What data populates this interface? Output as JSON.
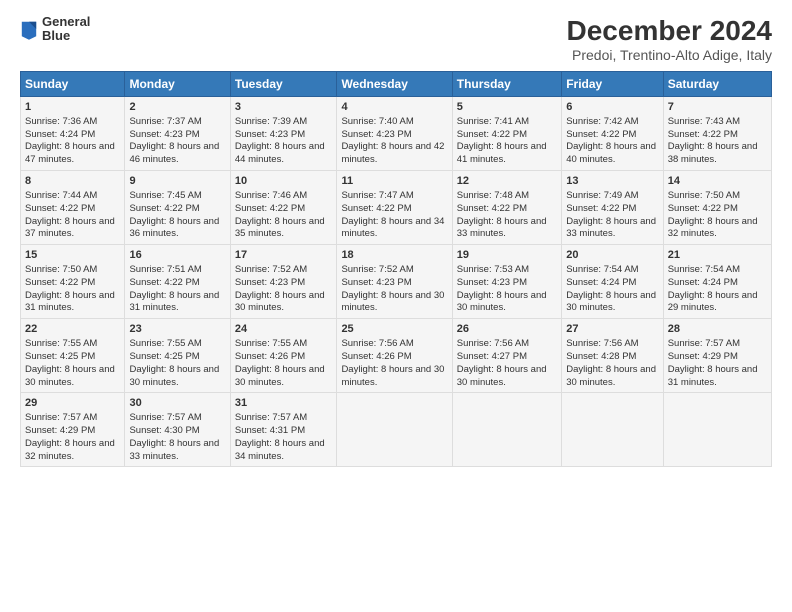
{
  "header": {
    "logo_line1": "General",
    "logo_line2": "Blue",
    "main_title": "December 2024",
    "subtitle": "Predoi, Trentino-Alto Adige, Italy"
  },
  "days_of_week": [
    "Sunday",
    "Monday",
    "Tuesday",
    "Wednesday",
    "Thursday",
    "Friday",
    "Saturday"
  ],
  "weeks": [
    [
      {
        "day": "1",
        "sunrise": "Sunrise: 7:36 AM",
        "sunset": "Sunset: 4:24 PM",
        "daylight": "Daylight: 8 hours and 47 minutes."
      },
      {
        "day": "2",
        "sunrise": "Sunrise: 7:37 AM",
        "sunset": "Sunset: 4:23 PM",
        "daylight": "Daylight: 8 hours and 46 minutes."
      },
      {
        "day": "3",
        "sunrise": "Sunrise: 7:39 AM",
        "sunset": "Sunset: 4:23 PM",
        "daylight": "Daylight: 8 hours and 44 minutes."
      },
      {
        "day": "4",
        "sunrise": "Sunrise: 7:40 AM",
        "sunset": "Sunset: 4:23 PM",
        "daylight": "Daylight: 8 hours and 42 minutes."
      },
      {
        "day": "5",
        "sunrise": "Sunrise: 7:41 AM",
        "sunset": "Sunset: 4:22 PM",
        "daylight": "Daylight: 8 hours and 41 minutes."
      },
      {
        "day": "6",
        "sunrise": "Sunrise: 7:42 AM",
        "sunset": "Sunset: 4:22 PM",
        "daylight": "Daylight: 8 hours and 40 minutes."
      },
      {
        "day": "7",
        "sunrise": "Sunrise: 7:43 AM",
        "sunset": "Sunset: 4:22 PM",
        "daylight": "Daylight: 8 hours and 38 minutes."
      }
    ],
    [
      {
        "day": "8",
        "sunrise": "Sunrise: 7:44 AM",
        "sunset": "Sunset: 4:22 PM",
        "daylight": "Daylight: 8 hours and 37 minutes."
      },
      {
        "day": "9",
        "sunrise": "Sunrise: 7:45 AM",
        "sunset": "Sunset: 4:22 PM",
        "daylight": "Daylight: 8 hours and 36 minutes."
      },
      {
        "day": "10",
        "sunrise": "Sunrise: 7:46 AM",
        "sunset": "Sunset: 4:22 PM",
        "daylight": "Daylight: 8 hours and 35 minutes."
      },
      {
        "day": "11",
        "sunrise": "Sunrise: 7:47 AM",
        "sunset": "Sunset: 4:22 PM",
        "daylight": "Daylight: 8 hours and 34 minutes."
      },
      {
        "day": "12",
        "sunrise": "Sunrise: 7:48 AM",
        "sunset": "Sunset: 4:22 PM",
        "daylight": "Daylight: 8 hours and 33 minutes."
      },
      {
        "day": "13",
        "sunrise": "Sunrise: 7:49 AM",
        "sunset": "Sunset: 4:22 PM",
        "daylight": "Daylight: 8 hours and 33 minutes."
      },
      {
        "day": "14",
        "sunrise": "Sunrise: 7:50 AM",
        "sunset": "Sunset: 4:22 PM",
        "daylight": "Daylight: 8 hours and 32 minutes."
      }
    ],
    [
      {
        "day": "15",
        "sunrise": "Sunrise: 7:50 AM",
        "sunset": "Sunset: 4:22 PM",
        "daylight": "Daylight: 8 hours and 31 minutes."
      },
      {
        "day": "16",
        "sunrise": "Sunrise: 7:51 AM",
        "sunset": "Sunset: 4:22 PM",
        "daylight": "Daylight: 8 hours and 31 minutes."
      },
      {
        "day": "17",
        "sunrise": "Sunrise: 7:52 AM",
        "sunset": "Sunset: 4:23 PM",
        "daylight": "Daylight: 8 hours and 30 minutes."
      },
      {
        "day": "18",
        "sunrise": "Sunrise: 7:52 AM",
        "sunset": "Sunset: 4:23 PM",
        "daylight": "Daylight: 8 hours and 30 minutes."
      },
      {
        "day": "19",
        "sunrise": "Sunrise: 7:53 AM",
        "sunset": "Sunset: 4:23 PM",
        "daylight": "Daylight: 8 hours and 30 minutes."
      },
      {
        "day": "20",
        "sunrise": "Sunrise: 7:54 AM",
        "sunset": "Sunset: 4:24 PM",
        "daylight": "Daylight: 8 hours and 30 minutes."
      },
      {
        "day": "21",
        "sunrise": "Sunrise: 7:54 AM",
        "sunset": "Sunset: 4:24 PM",
        "daylight": "Daylight: 8 hours and 29 minutes."
      }
    ],
    [
      {
        "day": "22",
        "sunrise": "Sunrise: 7:55 AM",
        "sunset": "Sunset: 4:25 PM",
        "daylight": "Daylight: 8 hours and 30 minutes."
      },
      {
        "day": "23",
        "sunrise": "Sunrise: 7:55 AM",
        "sunset": "Sunset: 4:25 PM",
        "daylight": "Daylight: 8 hours and 30 minutes."
      },
      {
        "day": "24",
        "sunrise": "Sunrise: 7:55 AM",
        "sunset": "Sunset: 4:26 PM",
        "daylight": "Daylight: 8 hours and 30 minutes."
      },
      {
        "day": "25",
        "sunrise": "Sunrise: 7:56 AM",
        "sunset": "Sunset: 4:26 PM",
        "daylight": "Daylight: 8 hours and 30 minutes."
      },
      {
        "day": "26",
        "sunrise": "Sunrise: 7:56 AM",
        "sunset": "Sunset: 4:27 PM",
        "daylight": "Daylight: 8 hours and 30 minutes."
      },
      {
        "day": "27",
        "sunrise": "Sunrise: 7:56 AM",
        "sunset": "Sunset: 4:28 PM",
        "daylight": "Daylight: 8 hours and 30 minutes."
      },
      {
        "day": "28",
        "sunrise": "Sunrise: 7:57 AM",
        "sunset": "Sunset: 4:29 PM",
        "daylight": "Daylight: 8 hours and 31 minutes."
      }
    ],
    [
      {
        "day": "29",
        "sunrise": "Sunrise: 7:57 AM",
        "sunset": "Sunset: 4:29 PM",
        "daylight": "Daylight: 8 hours and 32 minutes."
      },
      {
        "day": "30",
        "sunrise": "Sunrise: 7:57 AM",
        "sunset": "Sunset: 4:30 PM",
        "daylight": "Daylight: 8 hours and 33 minutes."
      },
      {
        "day": "31",
        "sunrise": "Sunrise: 7:57 AM",
        "sunset": "Sunset: 4:31 PM",
        "daylight": "Daylight: 8 hours and 34 minutes."
      },
      null,
      null,
      null,
      null
    ]
  ]
}
